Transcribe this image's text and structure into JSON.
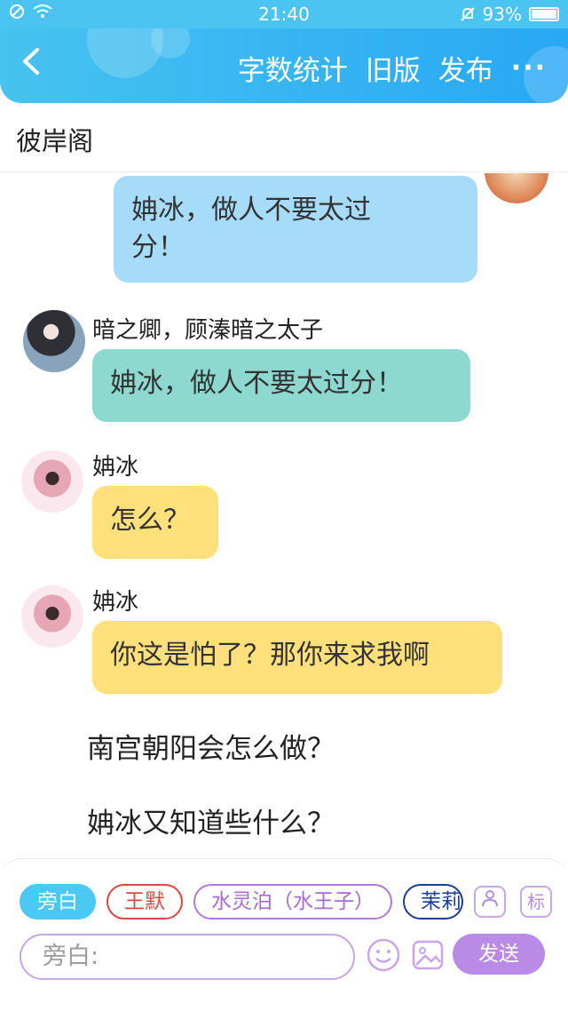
{
  "status": {
    "time": "21:40",
    "battery": "93%"
  },
  "header": {
    "back_icon": "chevron-left-icon",
    "actions": [
      "字数统计",
      "旧版",
      "发布"
    ],
    "more_label": "···"
  },
  "title": "彼岸阁",
  "messages": [
    {
      "speaker": "",
      "text1": "姌冰，做人不要太过",
      "text2": "分！",
      "color": "#a6dbfa"
    },
    {
      "speaker": "暗之卿，顾溱暗之太子",
      "text": "姌冰，做人不要太过分！",
      "color": "#8ed9cf"
    },
    {
      "speaker": "姌冰",
      "text": "怎么？",
      "color": "#ffe07a"
    },
    {
      "speaker": "姌冰",
      "text": "你这是怕了？那你来求我啊",
      "color": "#ffe07a"
    }
  ],
  "narration": [
    "南宫朝阳会怎么做？",
    "姌冰又知道些什么？"
  ],
  "bottom": {
    "chips": [
      "旁白",
      "王默",
      "水灵泊（水王子）",
      "茉莉"
    ],
    "role_icon_label": "",
    "tag_label": "标",
    "input_placeholder": "旁白:",
    "send_label": "发送"
  }
}
